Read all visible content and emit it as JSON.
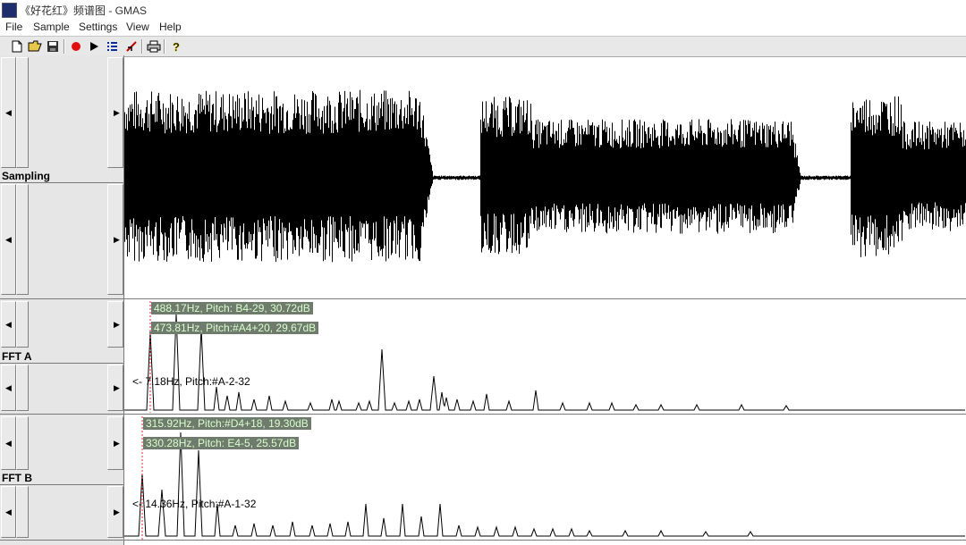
{
  "window": {
    "title": "《好花红》频谱图 - GMAS"
  },
  "menu": [
    "File",
    "Sample",
    "Settings",
    "View",
    "Help"
  ],
  "toolbar": {
    "icons": [
      "new-file-icon",
      "open-folder-icon",
      "save-icon",
      "record-icon",
      "play-icon",
      "list-icon",
      "marker-icon",
      "print-icon",
      "help-icon"
    ]
  },
  "panes": {
    "sampling_label": "Sampling",
    "ffta_label": "FFT A",
    "fftb_label": "FFT B"
  },
  "ffta": {
    "hl1": "488.17Hz, Pitch: B4-29,  30.72dB",
    "hl2": "473.81Hz, Pitch:#A4+20,  29.67dB",
    "info": "<-   7.18Hz, Pitch:#A-2-32"
  },
  "fftb": {
    "hl1": "315.92Hz, Pitch:#D4+18,  19.30dB",
    "hl2": "330.28Hz, Pitch: E4-5,  25.57dB",
    "info": "<-  14.36Hz, Pitch:#A-1-32"
  },
  "colors": {
    "highlight_bg": "#6f7b6c",
    "highlight_text": "#d9ffce",
    "cursor": "#e03030"
  }
}
